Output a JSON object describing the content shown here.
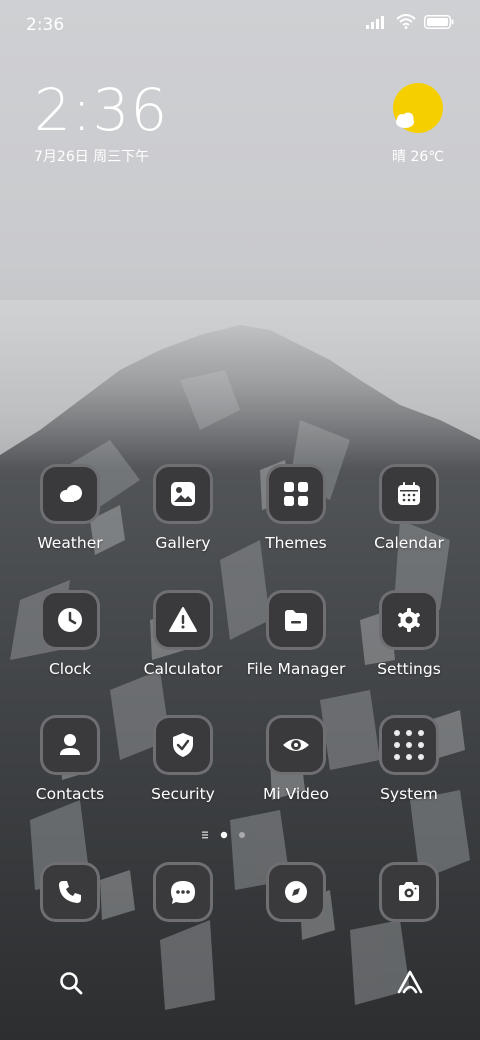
{
  "status_bar": {
    "time": "2:36"
  },
  "clock_widget": {
    "time": "2:36",
    "date": "7月26日 周三下午"
  },
  "weather_widget": {
    "condition_temp": "晴 26℃"
  },
  "apps": [
    {
      "label": "Weather",
      "icon": "weather-icon"
    },
    {
      "label": "Gallery",
      "icon": "gallery-icon"
    },
    {
      "label": "Themes",
      "icon": "themes-icon"
    },
    {
      "label": "Calendar",
      "icon": "calendar-icon"
    },
    {
      "label": "Clock",
      "icon": "clock-icon"
    },
    {
      "label": "Calculator",
      "icon": "calculator-icon"
    },
    {
      "label": "File Manager",
      "icon": "file-manager-icon"
    },
    {
      "label": "Settings",
      "icon": "settings-icon"
    },
    {
      "label": "Contacts",
      "icon": "contacts-icon"
    },
    {
      "label": "Security",
      "icon": "security-icon"
    },
    {
      "label": "Mi Video",
      "icon": "mi-video-icon"
    },
    {
      "label": "System",
      "icon": "system-folder-icon"
    }
  ],
  "dock": [
    {
      "icon": "phone-icon"
    },
    {
      "icon": "messages-icon"
    },
    {
      "icon": "browser-icon"
    },
    {
      "icon": "camera-icon"
    }
  ],
  "colors": {
    "icon_bg": "#3a3a3d",
    "sun": "#f5cf00",
    "icon_border": "#78787c"
  }
}
